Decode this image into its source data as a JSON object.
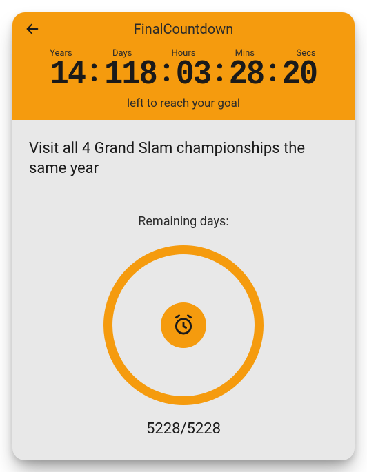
{
  "colors": {
    "accent": "#f59b0e",
    "bg": "#e8e8e8",
    "text": "#1a1a1a"
  },
  "header": {
    "title": "FinalCountdown",
    "labels": {
      "years": "Years",
      "days": "Days",
      "hours": "Hours",
      "mins": "Mins",
      "secs": "Secs"
    },
    "values": {
      "years": "14",
      "days": "118",
      "hours": "03",
      "mins": "28",
      "secs": "20"
    },
    "subtext": "left to reach your goal"
  },
  "body": {
    "goal_title": "Visit all 4 Grand Slam championships the same year",
    "remaining_label": "Remaining days:",
    "fraction": "5228/5228"
  }
}
